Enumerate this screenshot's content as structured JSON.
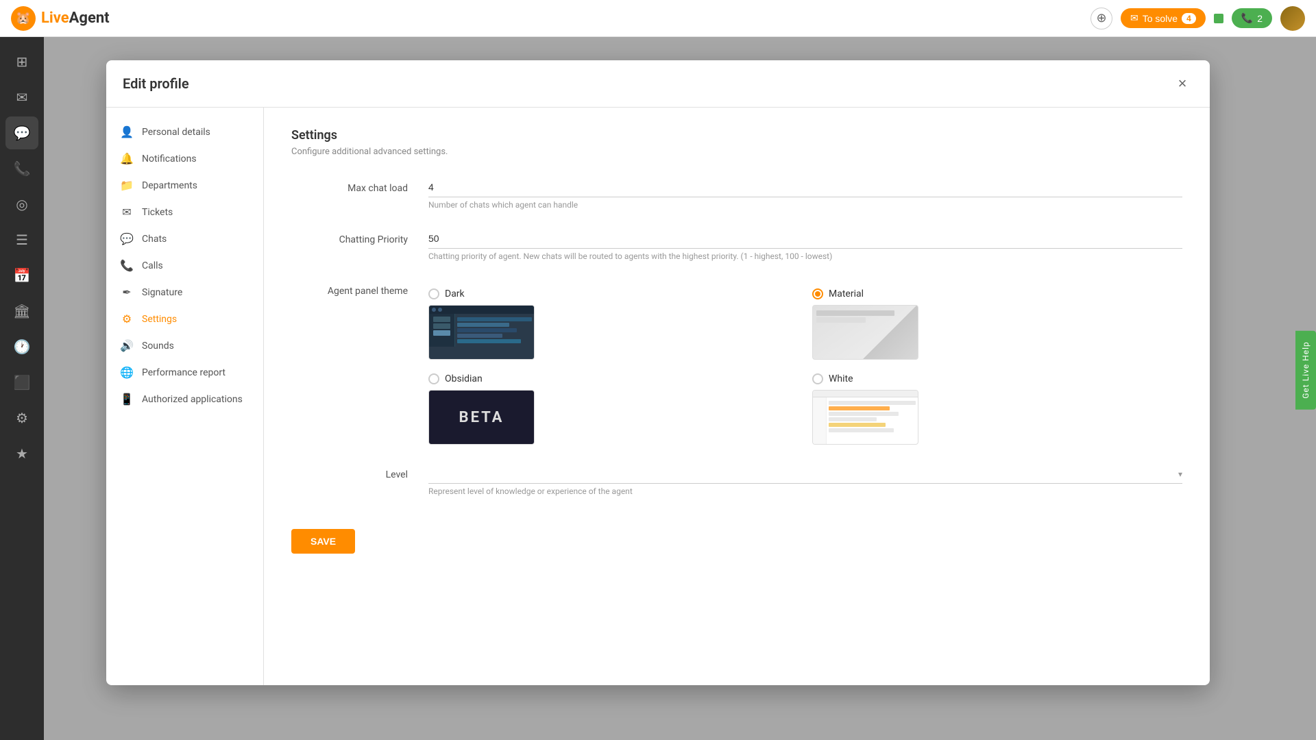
{
  "app": {
    "title": "LiveAgent",
    "logo_letter": "LA"
  },
  "navbar": {
    "to_solve_label": "To solve",
    "to_solve_count": "4",
    "call_count": "2",
    "add_icon": "⊕"
  },
  "sidebar": {
    "items": [
      {
        "id": "dashboard",
        "icon": "⊞",
        "active": false
      },
      {
        "id": "email",
        "icon": "✉",
        "active": false
      },
      {
        "id": "chat",
        "icon": "💬",
        "active": true
      },
      {
        "id": "phone",
        "icon": "📞",
        "active": false
      },
      {
        "id": "reports",
        "icon": "◎",
        "active": false
      },
      {
        "id": "tickets",
        "icon": "🎫",
        "active": false
      },
      {
        "id": "calendar1",
        "icon": "📅",
        "active": false
      },
      {
        "id": "customers",
        "icon": "👤",
        "active": false
      },
      {
        "id": "clock",
        "icon": "🕐",
        "active": false
      },
      {
        "id": "building",
        "icon": "🏛",
        "active": false
      },
      {
        "id": "settings",
        "icon": "⚙",
        "active": false
      },
      {
        "id": "star",
        "icon": "★",
        "active": false
      }
    ]
  },
  "modal": {
    "title": "Edit profile",
    "close_icon": "×",
    "nav_items": [
      {
        "id": "personal",
        "icon": "👤",
        "label": "Personal details"
      },
      {
        "id": "notifications",
        "icon": "🔔",
        "label": "Notifications"
      },
      {
        "id": "departments",
        "icon": "📁",
        "label": "Departments"
      },
      {
        "id": "tickets",
        "icon": "✉",
        "label": "Tickets"
      },
      {
        "id": "chats",
        "icon": "💬",
        "label": "Chats"
      },
      {
        "id": "calls",
        "icon": "📞",
        "label": "Calls"
      },
      {
        "id": "signature",
        "icon": "✒",
        "label": "Signature"
      },
      {
        "id": "settings",
        "icon": "⚙",
        "label": "Settings",
        "active": true
      },
      {
        "id": "sounds",
        "icon": "🔊",
        "label": "Sounds"
      },
      {
        "id": "performance",
        "icon": "🌐",
        "label": "Performance report"
      },
      {
        "id": "authorized",
        "icon": "📱",
        "label": "Authorized applications"
      }
    ],
    "settings": {
      "section_title": "Settings",
      "section_subtitle": "Configure additional advanced settings.",
      "max_chat_load_label": "Max chat load",
      "max_chat_load_value": "4",
      "max_chat_load_hint": "Number of chats which agent can handle",
      "chatting_priority_label": "Chatting Priority",
      "chatting_priority_value": "50",
      "chatting_priority_hint": "Chatting priority of agent. New chats will be routed to agents with the highest priority. (1 - highest, 100 - lowest)",
      "agent_panel_theme_label": "Agent panel theme",
      "themes": [
        {
          "id": "dark",
          "label": "Dark",
          "checked": false
        },
        {
          "id": "material",
          "label": "Material",
          "checked": true
        },
        {
          "id": "obsidian",
          "label": "Obsidian",
          "checked": false
        },
        {
          "id": "white",
          "label": "White",
          "checked": false
        }
      ],
      "level_label": "Level",
      "level_placeholder": "",
      "level_hint": "Represent level of knowledge or experience of the agent",
      "save_label": "SAVE"
    }
  },
  "live_help": {
    "label": "Get Live Help"
  }
}
